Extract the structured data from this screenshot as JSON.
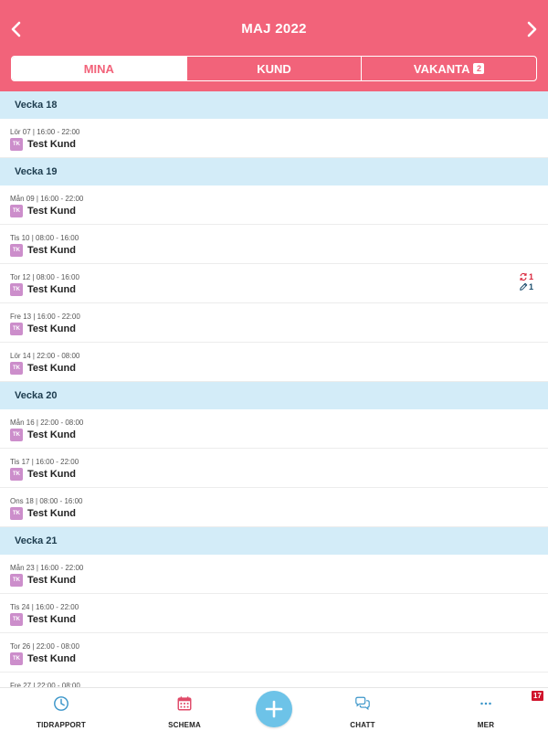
{
  "header": {
    "title": "MAJ 2022",
    "background": "#f2637a"
  },
  "tabs": [
    {
      "label": "MINA",
      "active": true
    },
    {
      "label": "KUND",
      "active": false
    },
    {
      "label": "VAKANTA",
      "active": false,
      "badge": "2"
    }
  ],
  "weeks": [
    {
      "label": "Vecka 18",
      "shifts": [
        {
          "time": "Lör 07 | 16:00 - 22:00",
          "initials": "TK",
          "client": "Test Kund"
        }
      ]
    },
    {
      "label": "Vecka 19",
      "shifts": [
        {
          "time": "Mån 09 | 16:00 - 22:00",
          "initials": "TK",
          "client": "Test Kund"
        },
        {
          "time": "Tis 10 | 08:00 - 16:00",
          "initials": "TK",
          "client": "Test Kund"
        },
        {
          "time": "Tor 12 | 08:00 - 16:00",
          "initials": "TK",
          "client": "Test Kund",
          "swap_count": "1",
          "edit_count": "1"
        },
        {
          "time": "Fre 13 | 16:00 - 22:00",
          "initials": "TK",
          "client": "Test Kund"
        },
        {
          "time": "Lör 14 | 22:00 - 08:00",
          "initials": "TK",
          "client": "Test Kund"
        }
      ]
    },
    {
      "label": "Vecka 20",
      "shifts": [
        {
          "time": "Mån 16 | 22:00 - 08:00",
          "initials": "TK",
          "client": "Test Kund"
        },
        {
          "time": "Tis 17 | 16:00 - 22:00",
          "initials": "TK",
          "client": "Test Kund"
        },
        {
          "time": "Ons 18 | 08:00 - 16:00",
          "initials": "TK",
          "client": "Test Kund"
        }
      ]
    },
    {
      "label": "Vecka 21",
      "shifts": [
        {
          "time": "Mån 23 | 16:00 - 22:00",
          "initials": "TK",
          "client": "Test Kund"
        },
        {
          "time": "Tis 24 | 16:00 - 22:00",
          "initials": "TK",
          "client": "Test Kund"
        },
        {
          "time": "Tor 26 | 22:00 - 08:00",
          "initials": "TK",
          "client": "Test Kund"
        },
        {
          "time": "Fre 27 | 22:00 - 08:00",
          "initials": "TK",
          "client": "Test Kund"
        }
      ]
    }
  ],
  "bottom_nav": {
    "tidrapport": {
      "label": "TIDRAPPORT",
      "icon": "clock-icon"
    },
    "schema": {
      "label": "SCHEMA",
      "icon": "calendar-icon"
    },
    "add": {
      "icon": "plus-icon"
    },
    "chatt": {
      "label": "CHATT",
      "icon": "chat-bubbles-icon"
    },
    "mer": {
      "label": "MER",
      "icon": "more-dots-icon",
      "badge": "17"
    }
  }
}
